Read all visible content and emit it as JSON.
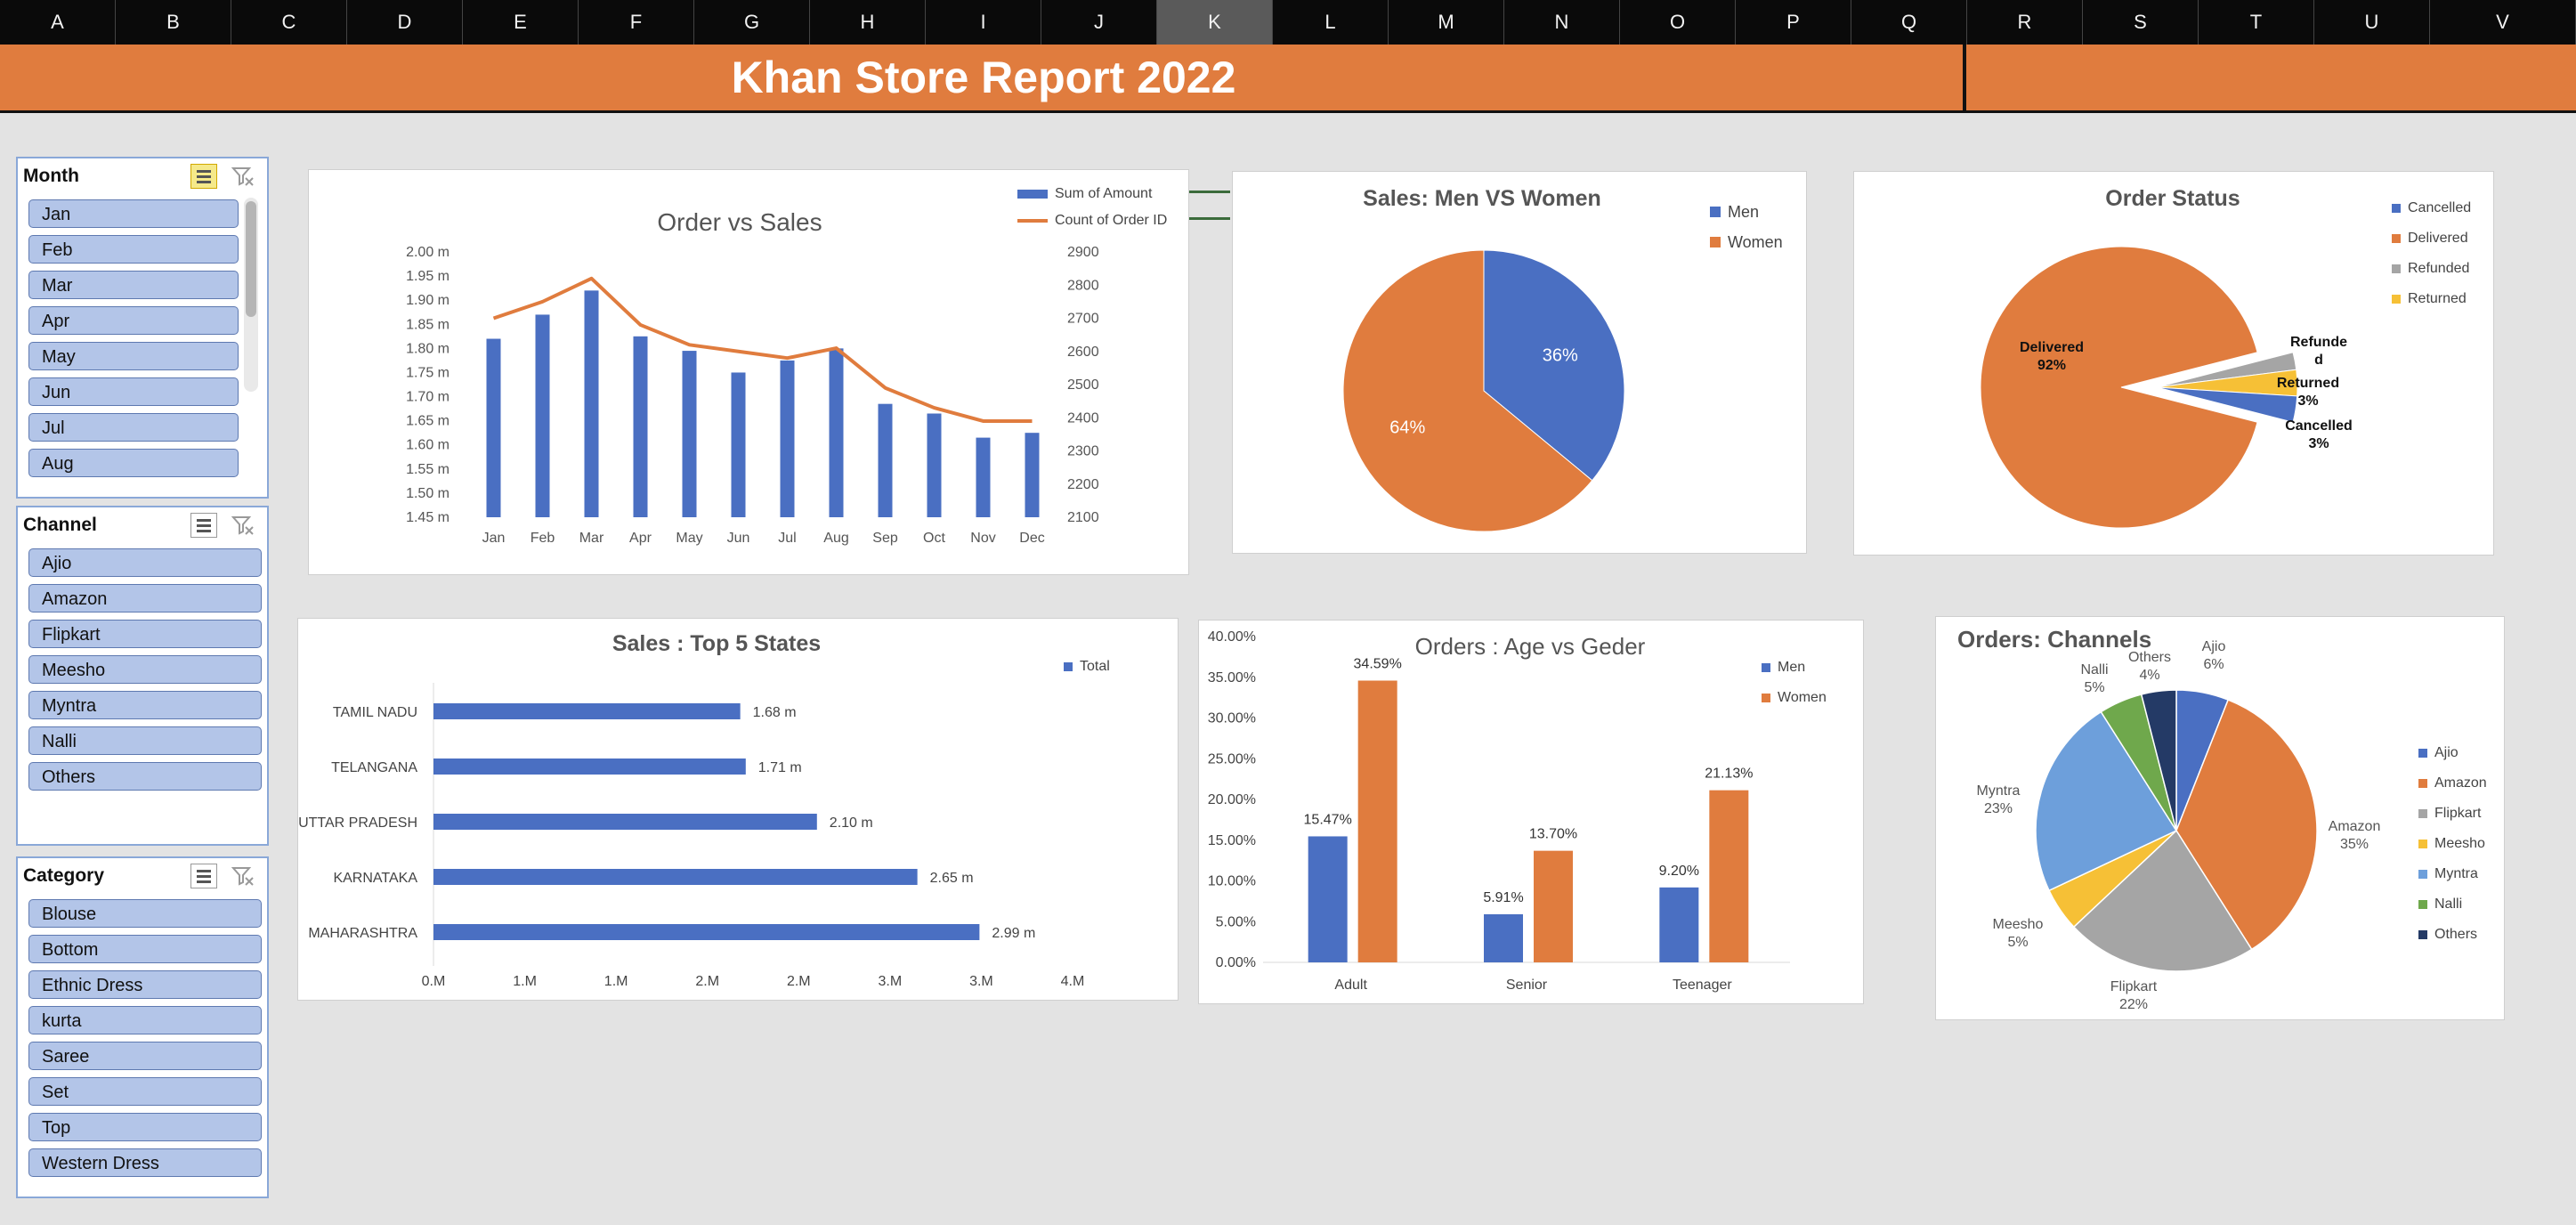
{
  "columns": [
    "A",
    "B",
    "C",
    "D",
    "E",
    "F",
    "G",
    "H",
    "I",
    "J",
    "K",
    "L",
    "M",
    "N",
    "O",
    "P",
    "Q",
    "R",
    "S",
    "T",
    "U",
    "V"
  ],
  "selected_column": "K",
  "report_title": "Khan Store Report 2022",
  "colors": {
    "blue": "#4a6fc2",
    "orange": "#e07c3e",
    "gray": "#a5a5a5",
    "yellow": "#f6c036",
    "lightblue": "#6d9fdb",
    "green": "#6fa84c",
    "navy": "#243a66",
    "banner": "#e07c3e"
  },
  "slicers": [
    {
      "title": "Month",
      "items": [
        "Jan",
        "Feb",
        "Mar",
        "Apr",
        "May",
        "Jun",
        "Jul",
        "Aug"
      ],
      "multi_select_icon": "multi-select-icon",
      "clear_icon": "clear-filter-icon"
    },
    {
      "title": "Channel",
      "items": [
        "Ajio",
        "Amazon",
        "Flipkart",
        "Meesho",
        "Myntra",
        "Nalli",
        "Others"
      ],
      "multi_select_icon": "multi-select-icon",
      "clear_icon": "clear-filter-icon"
    },
    {
      "title": "Category",
      "items": [
        "Blouse",
        "Bottom",
        "Ethnic Dress",
        "kurta",
        "Saree",
        "Set",
        "Top",
        "Western Dress"
      ],
      "multi_select_icon": "multi-select-icon",
      "clear_icon": "clear-filter-icon"
    }
  ],
  "chart_data": [
    {
      "type": "bar",
      "id": "order_vs_sales",
      "title": "Order vs Sales",
      "categories": [
        "Jan",
        "Feb",
        "Mar",
        "Apr",
        "May",
        "Jun",
        "Jul",
        "Aug",
        "Sep",
        "Oct",
        "Nov",
        "Dec"
      ],
      "series": [
        {
          "name": "Sum of Amount",
          "type": "bar",
          "axis": "left",
          "values": [
            1.82,
            1.87,
            1.92,
            1.825,
            1.795,
            1.75,
            1.775,
            1.8,
            1.685,
            1.665,
            1.615,
            1.625
          ]
        },
        {
          "name": "Count of Order ID",
          "type": "line",
          "axis": "right",
          "values": [
            2700,
            2750,
            2820,
            2680,
            2620,
            2600,
            2580,
            2610,
            2490,
            2430,
            2390,
            2390
          ]
        }
      ],
      "ylim": [
        1.45,
        2.0
      ],
      "y_ticks": [
        "2.00 m",
        "1.95 m",
        "1.90 m",
        "1.85 m",
        "1.80 m",
        "1.75 m",
        "1.70 m",
        "1.65 m",
        "1.60 m",
        "1.55 m",
        "1.50 m",
        "1.45 m"
      ],
      "y2lim": [
        2100,
        2900
      ],
      "y2_ticks": [
        "2900",
        "2800",
        "2700",
        "2600",
        "2500",
        "2400",
        "2300",
        "2200",
        "2100"
      ],
      "legend": [
        "Sum of Amount",
        "Count of Order ID"
      ],
      "legend_position": "top-right"
    },
    {
      "type": "pie",
      "id": "men_vs_women",
      "title": "Sales: Men VS  Women",
      "labels": [
        "Men",
        "Women"
      ],
      "values": [
        36,
        64
      ],
      "data_labels": [
        "36%",
        "64%"
      ],
      "legend_position": "top-right"
    },
    {
      "type": "pie",
      "id": "order_status",
      "title": "Order Status",
      "labels": [
        "Cancelled",
        "Delivered",
        "Refunded",
        "Returned"
      ],
      "values": [
        3,
        92,
        2,
        3
      ],
      "data_labels": {
        "Delivered": [
          "Delivered",
          "92%"
        ],
        "Refunded": [
          "Refunde",
          "d"
        ],
        "Returned": [
          "Returned",
          "3%"
        ],
        "Cancelled": [
          "Cancelled",
          "3%"
        ]
      },
      "legend_position": "top-right"
    },
    {
      "type": "bar",
      "orientation": "horizontal",
      "id": "top5_states",
      "title": "Sales : Top 5 States",
      "categories": [
        "TAMIL NADU",
        "TELANGANA",
        "UTTAR PRADESH",
        "KARNATAKA",
        "MAHARASHTRA"
      ],
      "values": [
        1.68,
        1.71,
        2.1,
        2.65,
        2.99
      ],
      "data_labels": [
        "1.68 m",
        "1.71 m",
        "2.10 m",
        "2.65 m",
        "2.99 m"
      ],
      "x_ticks": [
        "0.M",
        "1.M",
        "1.M",
        "2.M",
        "2.M",
        "3.M",
        "3.M",
        "4.M"
      ],
      "xlim": [
        0,
        3.5
      ],
      "legend": [
        "Total"
      ],
      "legend_position": "top-right"
    },
    {
      "type": "bar",
      "id": "age_vs_gender",
      "title": "Orders : Age vs Geder",
      "categories": [
        "Adult",
        "Senior",
        "Teenager"
      ],
      "series": [
        {
          "name": "Men",
          "values": [
            15.47,
            5.91,
            9.2
          ],
          "data_labels": [
            "15.47%",
            "5.91%",
            "9.20%"
          ]
        },
        {
          "name": "Women",
          "values": [
            34.59,
            13.7,
            21.13
          ],
          "data_labels": [
            "34.59%",
            "13.70%",
            "21.13%"
          ]
        }
      ],
      "ylim": [
        0,
        40
      ],
      "y_ticks": [
        "40.00%",
        "35.00%",
        "30.00%",
        "25.00%",
        "20.00%",
        "15.00%",
        "10.00%",
        "5.00%",
        "0.00%"
      ],
      "legend_position": "top-right"
    },
    {
      "type": "pie",
      "id": "channels",
      "title": "Orders: Channels",
      "labels": [
        "Ajio",
        "Amazon",
        "Flipkart",
        "Meesho",
        "Myntra",
        "Nalli",
        "Others"
      ],
      "values": [
        6,
        35,
        22,
        5,
        23,
        5,
        4
      ],
      "data_labels": [
        [
          "Ajio",
          "6%"
        ],
        [
          "Amazon",
          "35%"
        ],
        [
          "Flipkart",
          "22%"
        ],
        [
          "Meesho",
          "5%"
        ],
        [
          "Myntra",
          "23%"
        ],
        [
          "Nalli",
          "5%"
        ],
        [
          "Others",
          "4%"
        ]
      ],
      "legend_position": "right"
    }
  ]
}
